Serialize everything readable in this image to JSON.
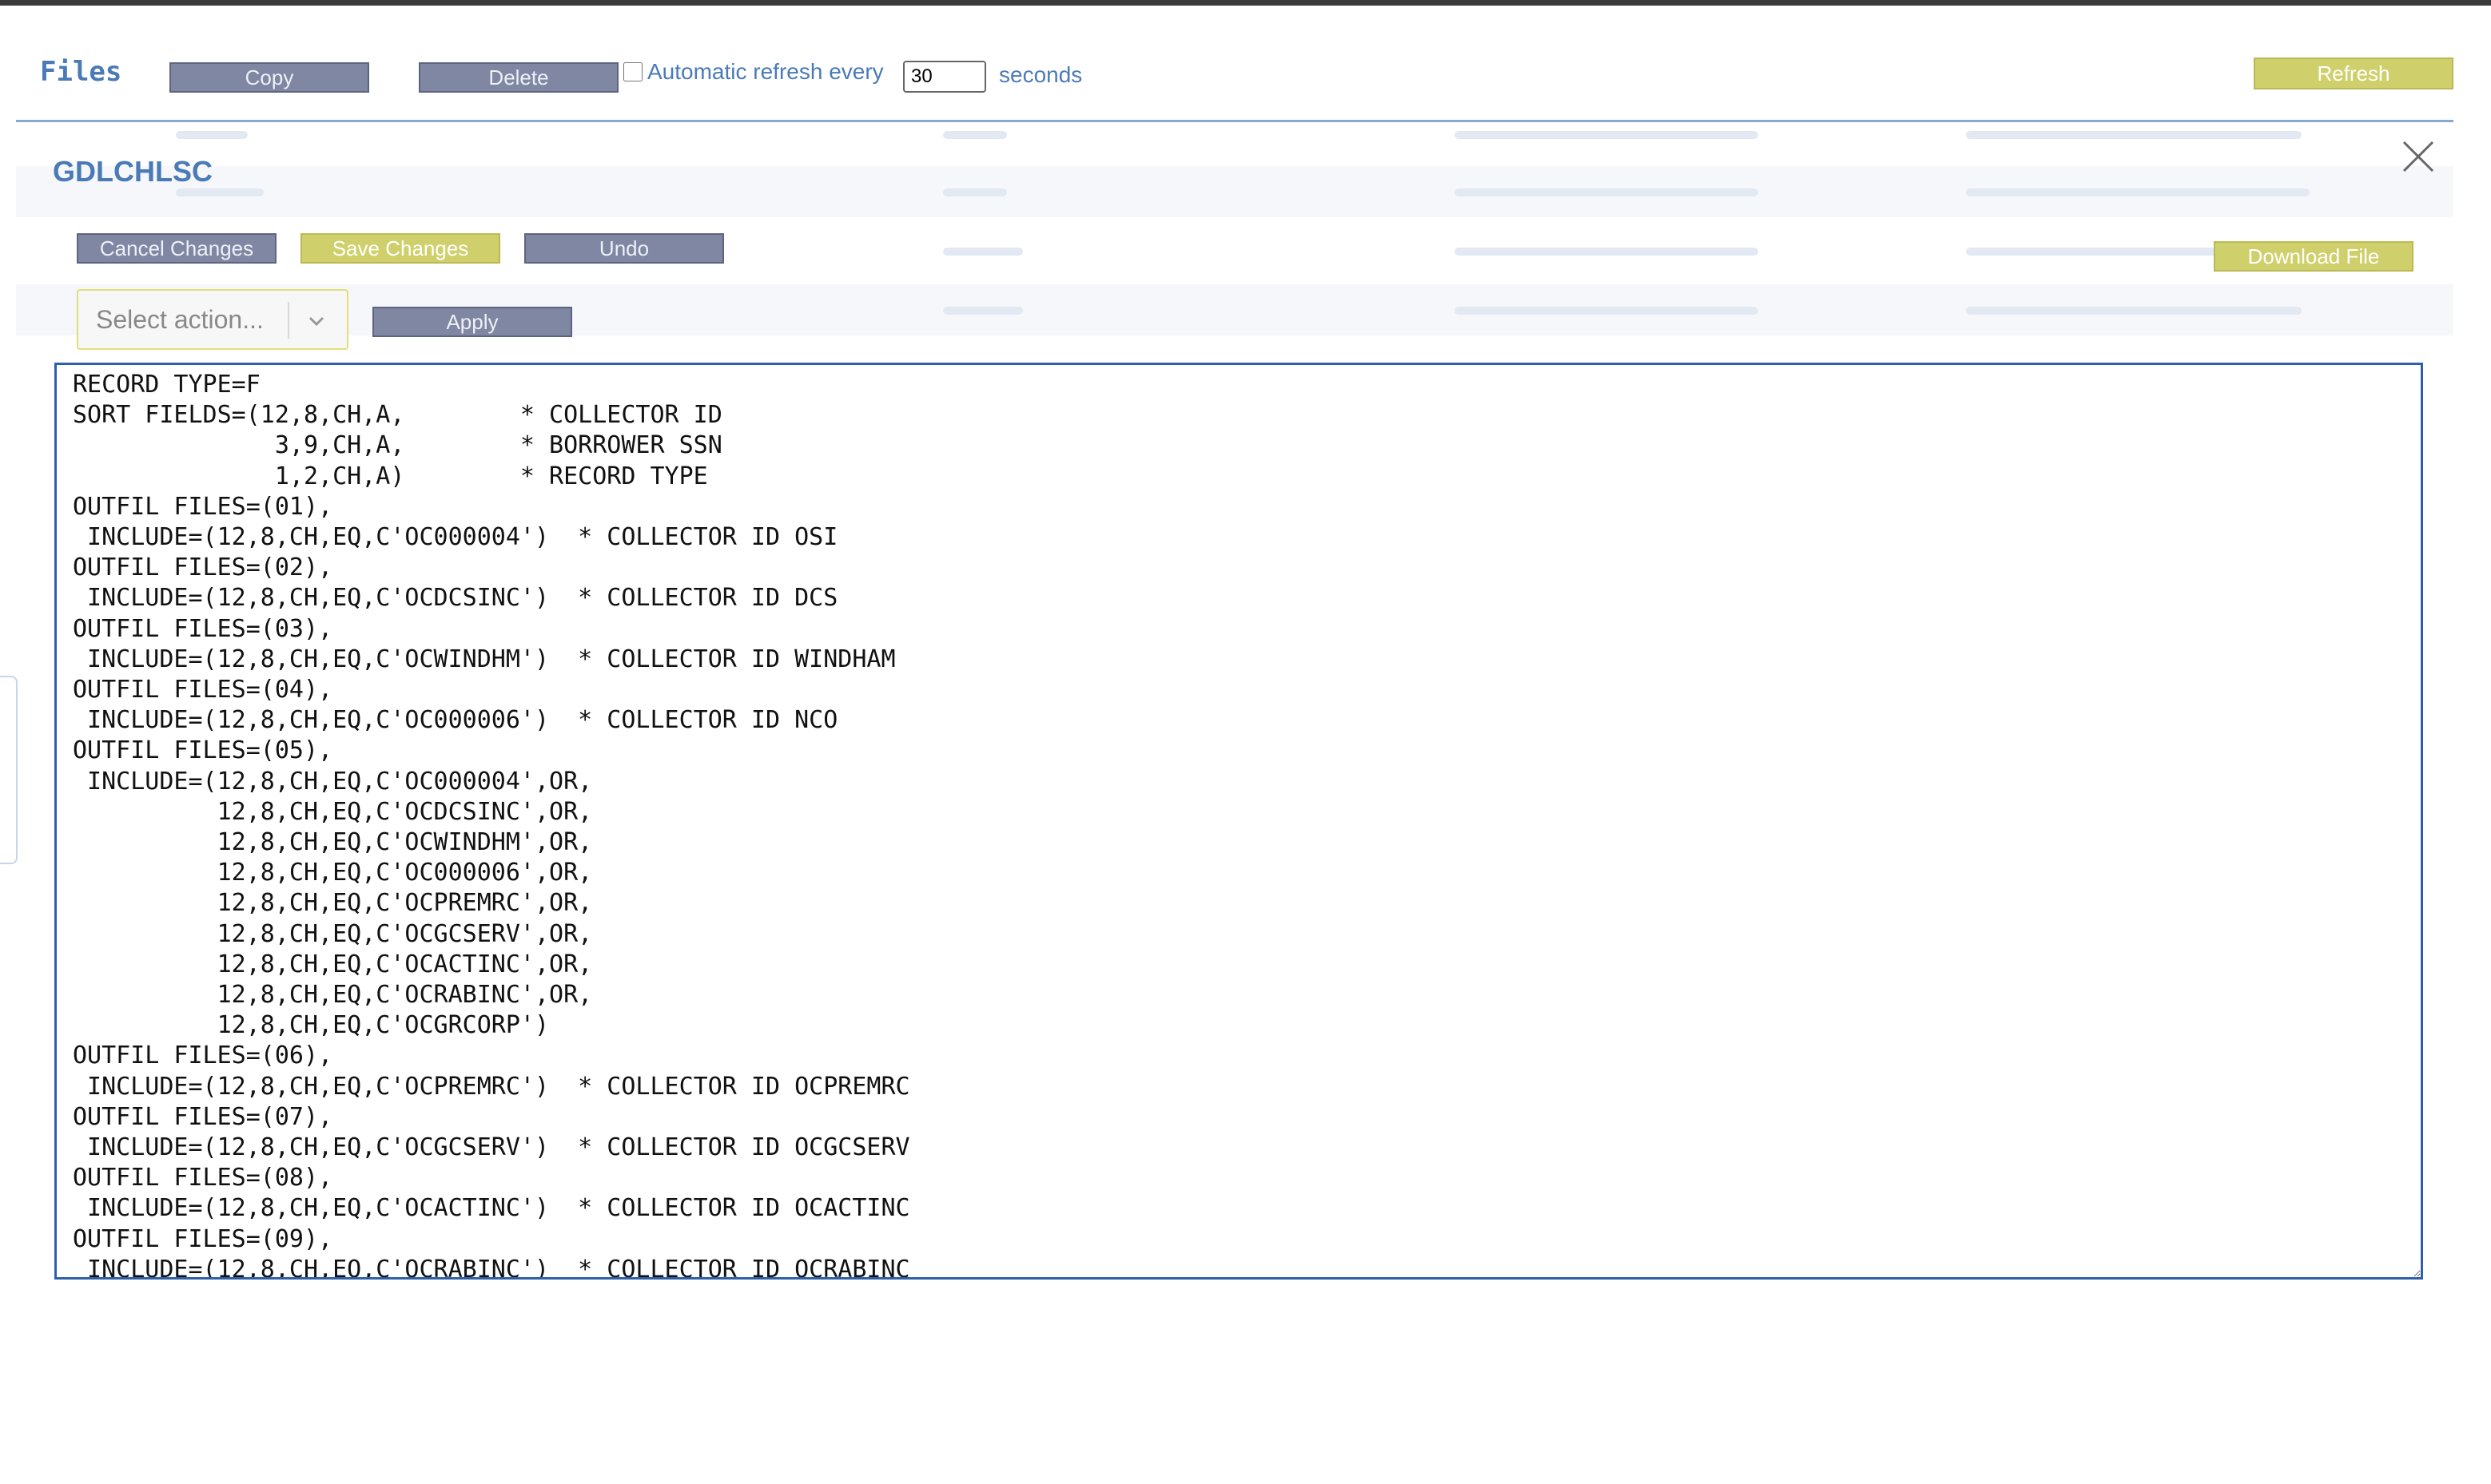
{
  "header": {
    "title": "Files",
    "copy_label": "Copy",
    "delete_label": "Delete",
    "auto_refresh_label": "Automatic refresh every",
    "refresh_interval": "30",
    "seconds_label": "seconds",
    "refresh_label": "Refresh"
  },
  "modal": {
    "title": "GDLCHLSC",
    "cancel_label": "Cancel Changes",
    "save_label": "Save Changes",
    "undo_label": "Undo",
    "download_label": "Download File",
    "action_placeholder": "Select action...",
    "apply_label": "Apply",
    "content_lines": [
      "RECORD TYPE=F",
      "SORT FIELDS=(12,8,CH,A,        * COLLECTOR ID",
      "              3,9,CH,A,        * BORROWER SSN",
      "              1,2,CH,A)        * RECORD TYPE",
      "OUTFIL FILES=(01),",
      " INCLUDE=(12,8,CH,EQ,C'OC000004')  * COLLECTOR ID OSI",
      "OUTFIL FILES=(02),",
      " INCLUDE=(12,8,CH,EQ,C'OCDCSINC')  * COLLECTOR ID DCS",
      "OUTFIL FILES=(03),",
      " INCLUDE=(12,8,CH,EQ,C'OCWINDHM')  * COLLECTOR ID WINDHAM",
      "OUTFIL FILES=(04),",
      " INCLUDE=(12,8,CH,EQ,C'OC000006')  * COLLECTOR ID NCO",
      "OUTFIL FILES=(05),",
      " INCLUDE=(12,8,CH,EQ,C'OC000004',OR,",
      "          12,8,CH,EQ,C'OCDCSINC',OR,",
      "          12,8,CH,EQ,C'OCWINDHM',OR,",
      "          12,8,CH,EQ,C'OC000006',OR,",
      "          12,8,CH,EQ,C'OCPREMRC',OR,",
      "          12,8,CH,EQ,C'OCGCSERV',OR,",
      "          12,8,CH,EQ,C'OCACTINC',OR,",
      "          12,8,CH,EQ,C'OCRABINC',OR,",
      "          12,8,CH,EQ,C'OCGRCORP')",
      "OUTFIL FILES=(06),",
      " INCLUDE=(12,8,CH,EQ,C'OCPREMRC')  * COLLECTOR ID OCPREMRC",
      "OUTFIL FILES=(07),",
      " INCLUDE=(12,8,CH,EQ,C'OCGCSERV')  * COLLECTOR ID OCGCSERV",
      "OUTFIL FILES=(08),",
      " INCLUDE=(12,8,CH,EQ,C'OCACTINC')  * COLLECTOR ID OCACTINC",
      "OUTFIL FILES=(09),",
      " INCLUDE=(12,8,CH,EQ,C'OCRABINC')  * COLLECTOR ID OCRABINC"
    ]
  },
  "colors": {
    "accent": "#4a7bb7",
    "button_gray": "#7f87a3",
    "button_yellow": "#cfd06b",
    "editor_border": "#2f5fa8"
  },
  "icons": {
    "close": "close-icon",
    "dropdown": "chevron-down-icon"
  }
}
